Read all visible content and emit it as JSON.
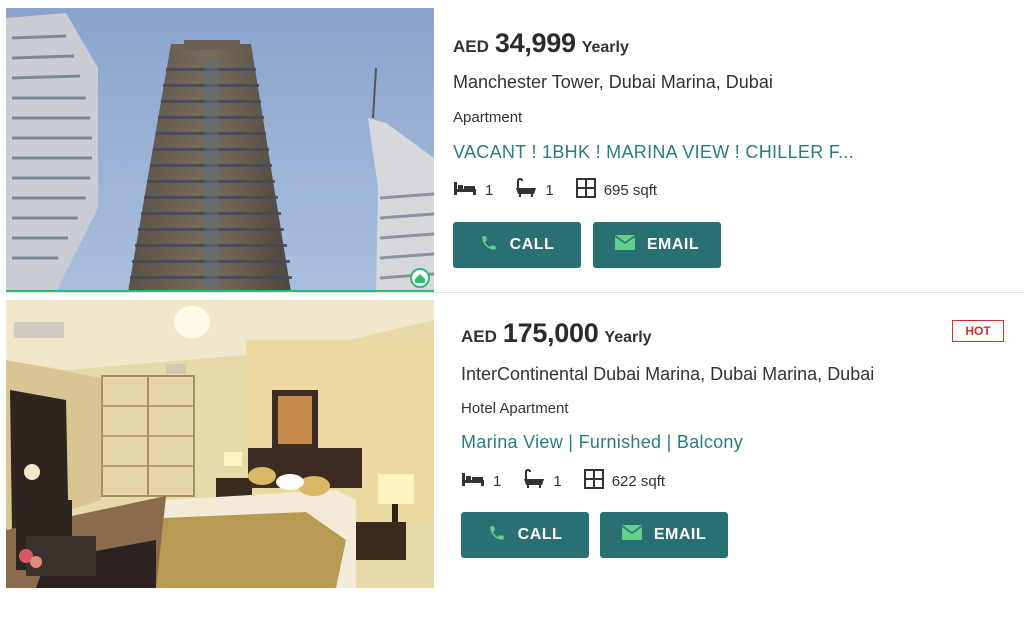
{
  "listings": [
    {
      "price": {
        "currency": "AED",
        "amount": "34,999",
        "period": "Yearly"
      },
      "location": "Manchester Tower, Dubai Marina, Dubai",
      "property_type": "Apartment",
      "headline": "VACANT ! 1BHK ! MARINA VIEW ! CHILLER F...",
      "bedrooms": "1",
      "bathrooms": "1",
      "area": "695 sqft",
      "call_label": "CALL",
      "email_label": "EMAIL",
      "badge": ""
    },
    {
      "price": {
        "currency": "AED",
        "amount": "175,000",
        "period": "Yearly"
      },
      "location": "InterContinental Dubai Marina, Dubai Marina, Dubai",
      "property_type": "Hotel Apartment",
      "headline": "Marina View | Furnished | Balcony",
      "bedrooms": "1",
      "bathrooms": "1",
      "area": "622 sqft",
      "call_label": "CALL",
      "email_label": "EMAIL",
      "badge": "HOT"
    }
  ],
  "colors": {
    "button_bg": "#2a6f72",
    "headline_teal": "#2b7c80",
    "badge_red": "#d32f2f",
    "icon_green": "#5fcf8a"
  },
  "icons": [
    "bed-icon",
    "bath-icon",
    "area-icon",
    "phone-icon",
    "envelope-icon",
    "verified-home-icon"
  ]
}
